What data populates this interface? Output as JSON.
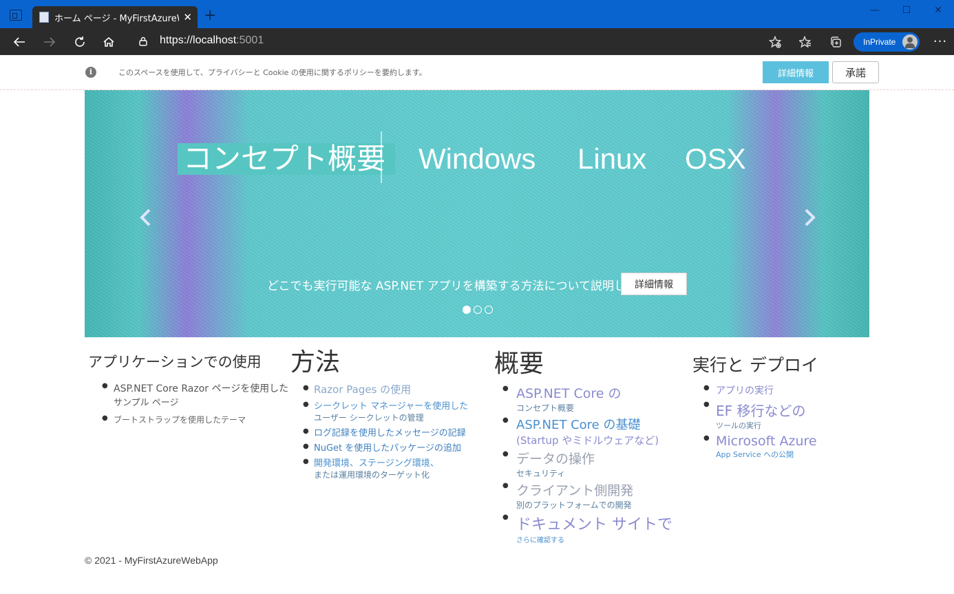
{
  "browser": {
    "tab_title": "ホーム ページ - MyFirstAzureWebApp",
    "url_main": "https://localhost",
    "url_port": ":5001",
    "inprivate_label": "InPrivate",
    "win_minimize": "—",
    "win_maximize": "☐",
    "win_close": "✕",
    "new_tab": "+",
    "more": "···"
  },
  "cookie_banner": {
    "text": "このスペースを使用して、プライバシーと Cookie の使用に関するポリシーを要約します。",
    "info_button": "詳細情報",
    "accept_button": "承諾"
  },
  "carousel": {
    "items": [
      "コンセプト概要",
      "Windows",
      "Linux",
      "OSX"
    ],
    "caption": "どこでも実行可能な ASP.NET アプリを構築する方法について説明します。",
    "button": "詳細情報",
    "active_index": 0
  },
  "columns": {
    "app": {
      "title": "アプリケーションでの使用",
      "items": [
        {
          "main": "ASP.NET Core Razor ページを使用した",
          "sub": "サンプル ページ"
        },
        {
          "main": "ブートストラップを使用したテーマ"
        }
      ]
    },
    "howto": {
      "title": "方法",
      "items": [
        {
          "main": "Razor Pages の使用"
        },
        {
          "main": "シークレット マネージャーを使用した",
          "sub": "ユーザー シークレットの管理"
        },
        {
          "main": "ログ記録を使用したメッセージの記録"
        },
        {
          "main": "NuGet を使用したパッケージの追加"
        },
        {
          "main": "開発環境、ステージング環境、",
          "sub": "または運用環境のターゲット化"
        }
      ]
    },
    "overview": {
      "title": "概要",
      "items": [
        {
          "main": "ASP.NET Core の",
          "sub": "コンセプト概要"
        },
        {
          "main": "ASP.NET Core の基礎",
          "sub": "(Startup やミドルウェアなど)"
        },
        {
          "main": "データの操作",
          "sub": "セキュリティ"
        },
        {
          "main": "クライアント側開発",
          "sub": "別のプラットフォームでの開発"
        },
        {
          "main": "ドキュメント サイトで",
          "sub": "さらに確認する"
        }
      ]
    },
    "deploy": {
      "title": "実行と デプロイ",
      "items": [
        {
          "main": "アプリの実行"
        },
        {
          "main": "EF 移行などの",
          "sub": "ツールの実行"
        },
        {
          "main": "Microsoft Azure",
          "sub": "App Service への公開"
        }
      ]
    }
  },
  "footer": "© 2021 - MyFirstAzureWebApp",
  "colors": {
    "titlebar": "#0a64d0",
    "addrbar": "#2b2b2b",
    "info_button": "#5bc0de",
    "carousel": "#61cccf"
  }
}
